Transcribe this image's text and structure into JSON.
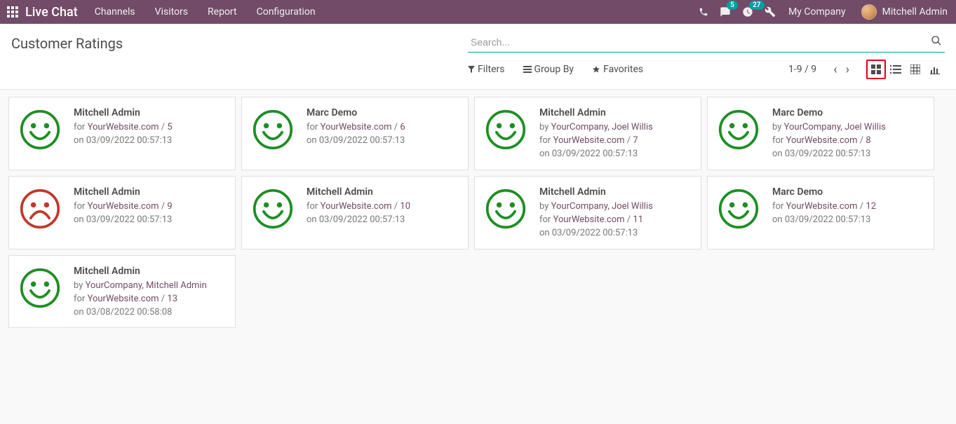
{
  "navbar": {
    "brand": "Live Chat",
    "menu": [
      "Channels",
      "Visitors",
      "Report",
      "Configuration"
    ],
    "messages_badge": "5",
    "activities_badge": "27",
    "company": "My Company",
    "username": "Mitchell Admin"
  },
  "page": {
    "title": "Customer Ratings",
    "search_placeholder": "Search..."
  },
  "toolbar": {
    "filters": "Filters",
    "group_by": "Group By",
    "favorites": "Favorites",
    "pager": "1-9 / 9"
  },
  "labels": {
    "by_prefix": "by ",
    "for_prefix": "for ",
    "on_prefix": "on ",
    "slash": " / "
  },
  "colors": {
    "happy": "#1e8e24",
    "sad": "#c0392b"
  },
  "cards": [
    {
      "name": "Mitchell Admin",
      "by": null,
      "for": "YourWebsite.com",
      "num": "5",
      "on": "03/09/2022 00:57:13",
      "face": "happy"
    },
    {
      "name": "Marc Demo",
      "by": null,
      "for": "YourWebsite.com",
      "num": "6",
      "on": "03/09/2022 00:57:13",
      "face": "happy"
    },
    {
      "name": "Mitchell Admin",
      "by": "YourCompany, Joel Willis",
      "for": "YourWebsite.com",
      "num": "7",
      "on": "03/09/2022 00:57:13",
      "face": "happy"
    },
    {
      "name": "Marc Demo",
      "by": "YourCompany, Joel Willis",
      "for": "YourWebsite.com",
      "num": "8",
      "on": "03/09/2022 00:57:13",
      "face": "happy"
    },
    {
      "name": "Mitchell Admin",
      "by": null,
      "for": "YourWebsite.com",
      "num": "9",
      "on": "03/09/2022 00:57:13",
      "face": "sad"
    },
    {
      "name": "Mitchell Admin",
      "by": null,
      "for": "YourWebsite.com",
      "num": "10",
      "on": "03/09/2022 00:57:13",
      "face": "happy"
    },
    {
      "name": "Mitchell Admin",
      "by": "YourCompany, Joel Willis",
      "for": "YourWebsite.com",
      "num": "11",
      "on": "03/09/2022 00:57:13",
      "face": "happy"
    },
    {
      "name": "Marc Demo",
      "by": null,
      "for": "YourWebsite.com",
      "num": "12",
      "on": "03/09/2022 00:57:13",
      "face": "happy"
    },
    {
      "name": "Mitchell Admin",
      "by": "YourCompany, Mitchell Admin",
      "for": "YourWebsite.com",
      "num": "13",
      "on": "03/08/2022 00:58:08",
      "face": "happy"
    }
  ]
}
